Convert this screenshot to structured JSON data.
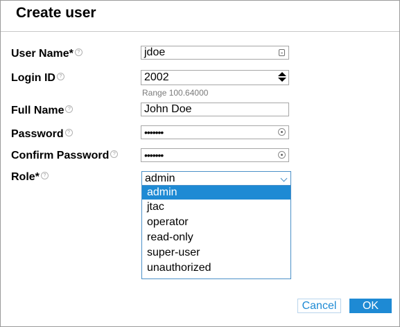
{
  "dialog": {
    "title": "Create user"
  },
  "form": {
    "username": {
      "label": "User Name*",
      "value": "jdoe"
    },
    "login_id": {
      "label": "Login ID",
      "value": "2002",
      "hint": "Range 100.64000"
    },
    "full_name": {
      "label": "Full Name",
      "value": "John Doe"
    },
    "password": {
      "label": "Password",
      "value": "•••••••"
    },
    "confirm_password": {
      "label": "Confirm Password",
      "value": "•••••••"
    },
    "role": {
      "label": "Role*",
      "value": "admin",
      "options": [
        "admin",
        "jtac",
        "operator",
        "read-only",
        "super-user",
        "unauthorized"
      ]
    }
  },
  "buttons": {
    "cancel": "Cancel",
    "ok": "OK"
  },
  "help_glyph": "?",
  "colors": {
    "accent": "#1e8ad4",
    "border": "#a6a6a6"
  },
  "icons": {
    "help": "help-icon",
    "username_suffix": "card-icon",
    "spinner": "spinner-icon",
    "password_reveal": "eye-icon",
    "dropdown": "chevron-down-icon"
  }
}
